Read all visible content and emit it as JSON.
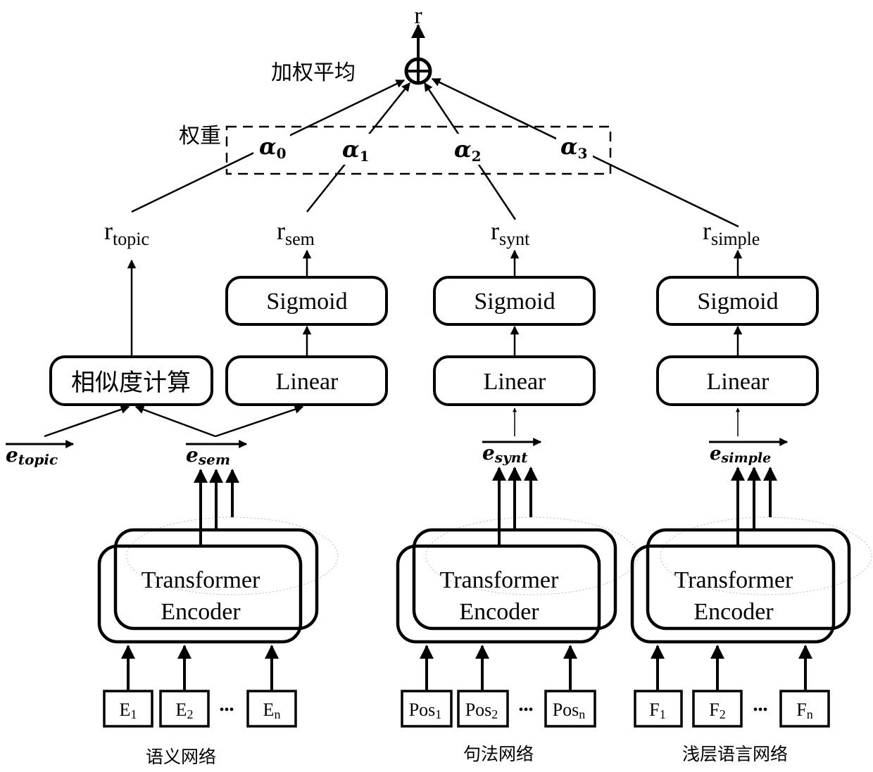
{
  "diagram": {
    "output": {
      "label": "r",
      "combine_symbol": "⊕",
      "combine_label": "加权平均"
    },
    "weights": {
      "label": "权重",
      "items": [
        {
          "symbol": "α",
          "sub": "0"
        },
        {
          "symbol": "α",
          "sub": "1"
        },
        {
          "symbol": "α",
          "sub": "2"
        },
        {
          "symbol": "α",
          "sub": "3"
        }
      ]
    },
    "scores": [
      {
        "base": "r",
        "sub": "topic"
      },
      {
        "base": "r",
        "sub": "sem"
      },
      {
        "base": "r",
        "sub": "synt"
      },
      {
        "base": "r",
        "sub": "simple"
      }
    ],
    "modules": {
      "similarity": "相似度计算",
      "sigmoid": "Sigmoid",
      "linear": "Linear",
      "encoder_line1": "Transformer",
      "encoder_line2": "Encoder"
    },
    "embeddings": [
      {
        "base": "e",
        "sub": "topic"
      },
      {
        "base": "e",
        "sub": "sem"
      },
      {
        "base": "e",
        "sub": "synt"
      },
      {
        "base": "e",
        "sub": "simple"
      }
    ],
    "networks": [
      {
        "name": "语义网络",
        "inputs": [
          {
            "base": "E",
            "sub": "1"
          },
          {
            "base": "E",
            "sub": "2"
          },
          {
            "base": "E",
            "sub": "n"
          }
        ],
        "ellipsis": "•••"
      },
      {
        "name": "句法网络",
        "inputs": [
          {
            "base": "Pos",
            "sub": "1"
          },
          {
            "base": "Pos",
            "sub": "2"
          },
          {
            "base": "Pos",
            "sub": "n"
          }
        ],
        "ellipsis": "•••"
      },
      {
        "name": "浅层语言网络",
        "inputs": [
          {
            "base": "F",
            "sub": "1"
          },
          {
            "base": "F",
            "sub": "2"
          },
          {
            "base": "F",
            "sub": "n"
          }
        ],
        "ellipsis": "•••"
      }
    ]
  }
}
